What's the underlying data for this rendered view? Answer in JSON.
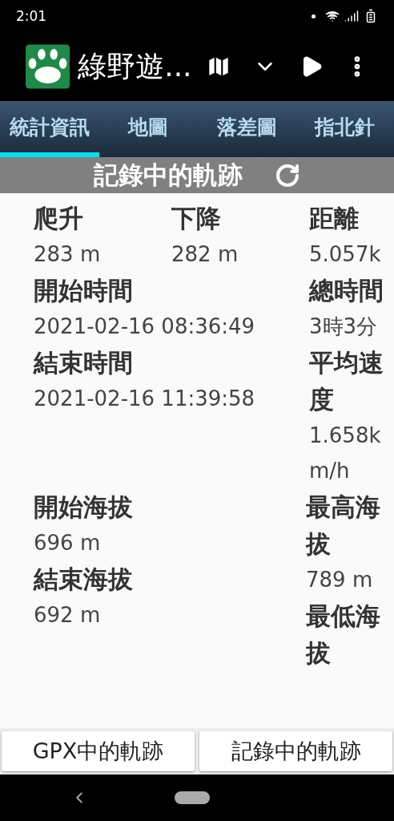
{
  "status_bar": {
    "time": "2:01"
  },
  "app_bar": {
    "title": "綠野遊..."
  },
  "tabs": [
    {
      "label": "統計資訊",
      "selected": true
    },
    {
      "label": "地圖",
      "selected": false
    },
    {
      "label": "落差圖",
      "selected": false
    },
    {
      "label": "指北針",
      "selected": false
    }
  ],
  "header": {
    "title": "記錄中的軌跡"
  },
  "stats": {
    "grid_rows": [
      [
        {
          "label": "爬升",
          "value": "283 m"
        },
        {
          "label": "下降",
          "value": "282 m"
        },
        {
          "label": "距離",
          "value": "5.057k"
        }
      ],
      [
        {
          "label": "開始時間",
          "value": "2021-02-16 08:36:49"
        },
        {
          "label": "總時間",
          "value": "3時3分"
        }
      ],
      [
        {
          "label": "結束時間",
          "value": "2021-02-16 11:39:58"
        },
        {
          "label": "平均速度",
          "value": "1.658km/h"
        }
      ]
    ],
    "left_column": [
      {
        "label": "開始海拔",
        "value": "696 m"
      },
      {
        "label": "結束海拔",
        "value": "692 m"
      }
    ],
    "right_column": [
      {
        "label": "最高海拔",
        "value": "789 m"
      },
      {
        "label": "最低海拔"
      }
    ]
  },
  "buttons": [
    {
      "label": "GPX中的軌跡"
    },
    {
      "label": "記錄中的軌跡"
    }
  ]
}
